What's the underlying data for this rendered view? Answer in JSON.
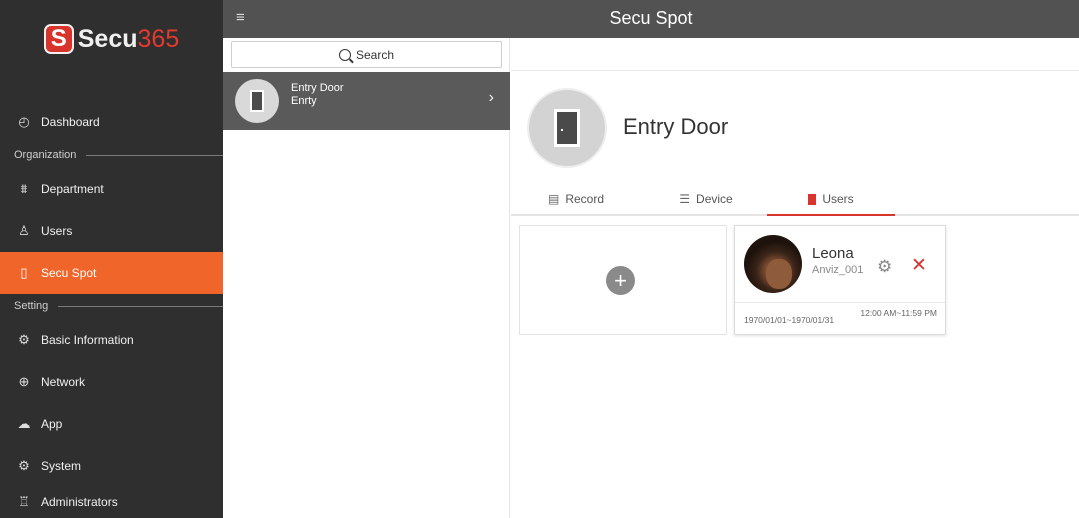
{
  "brand": {
    "badge": "S",
    "name": "Secu",
    "number": "365"
  },
  "header": {
    "title": "Secu Spot",
    "menu_icon": "hamburger-icon"
  },
  "sidebar": {
    "items": [
      {
        "label": "Dashboard",
        "icon": "dashboard-icon"
      },
      {
        "label": "Department",
        "icon": "department-icon"
      },
      {
        "label": "Users",
        "icon": "user-icon"
      },
      {
        "label": "Secu Spot",
        "icon": "door-icon",
        "active": true
      },
      {
        "label": "Basic Information",
        "icon": "gear-icon"
      },
      {
        "label": "Network",
        "icon": "globe-icon"
      },
      {
        "label": "App",
        "icon": "cloud-icon"
      },
      {
        "label": "System",
        "icon": "gear-icon"
      },
      {
        "label": "Administrators",
        "icon": "admin-icon"
      }
    ],
    "sections": {
      "organization": "Organization",
      "setting": "Setting"
    }
  },
  "search": {
    "label": "Search"
  },
  "list": {
    "items": [
      {
        "name": "Entry Door",
        "sub": "Enrty",
        "selected": true
      }
    ]
  },
  "detail": {
    "title": "Entry Door",
    "tabs": [
      {
        "label": "Record"
      },
      {
        "label": "Device"
      },
      {
        "label": "Users",
        "active": true
      }
    ],
    "add_symbol": "+",
    "users": [
      {
        "name": "Leona",
        "sub": "Anviz_001",
        "date_range": "1970/01/01~1970/01/31",
        "time_range": "12:00 AM~11:59 PM"
      }
    ]
  },
  "colors": {
    "accent": "#f0652a",
    "danger": "#d8342e",
    "sidebar_bg": "#2f2f2f",
    "topbar_bg": "#525252"
  }
}
